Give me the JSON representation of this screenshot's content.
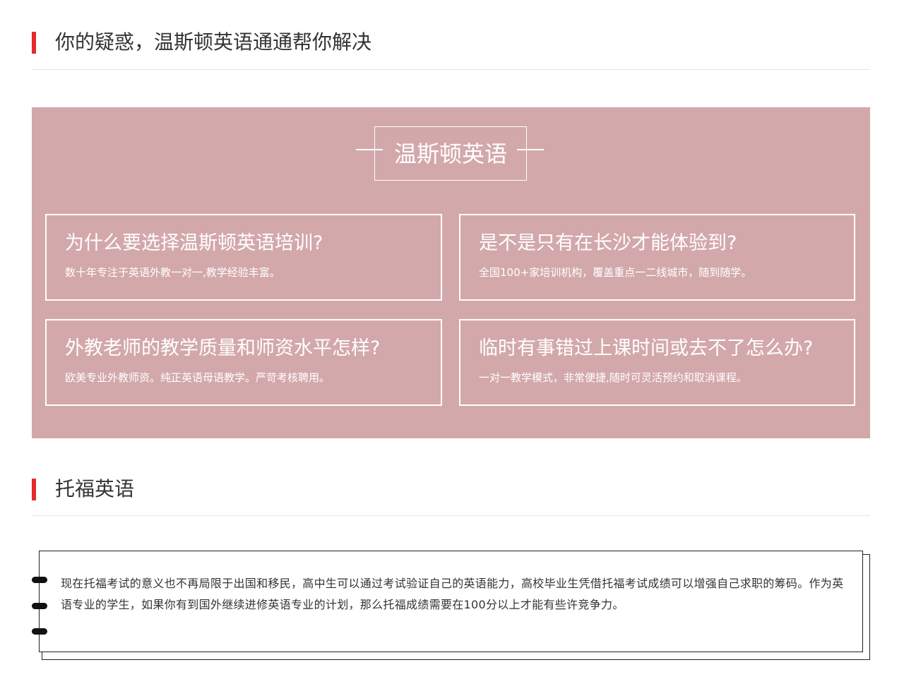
{
  "faq_section": {
    "heading": "你的疑惑，温斯顿英语通通帮你解决",
    "accent_color": "#e32b2b",
    "panel_color": "#d3a8ab",
    "brand": "温斯顿英语",
    "cards": [
      {
        "question": "为什么要选择温斯顿英语培训?",
        "answer": "数十年专注于英语外教一对一,教学经验丰富。"
      },
      {
        "question": "是不是只有在长沙才能体验到?",
        "answer": "全国100+家培训机构，覆盖重点一二线城市，随到随学。"
      },
      {
        "question": "外教老师的教学质量和师资水平怎样?",
        "answer": "欧美专业外教师资。纯正英语母语教学。严苛考核聘用。"
      },
      {
        "question": "临时有事错过上课时间或去不了怎么办?",
        "answer": "一对一教学模式，非常便捷,随时可灵活预约和取消课程。"
      }
    ]
  },
  "toefl_section": {
    "heading": "托福英语",
    "paragraph": "现在托福考试的意义也不再局限于出国和移民，高中生可以通过考试验证自己的英语能力，高校毕业生凭借托福考试成绩可以增强自己求职的筹码。作为英语专业的学生，如果你有到国外继续进修英语专业的计划，那么托福成绩需要在100分以上才能有些许竞争力。"
  }
}
